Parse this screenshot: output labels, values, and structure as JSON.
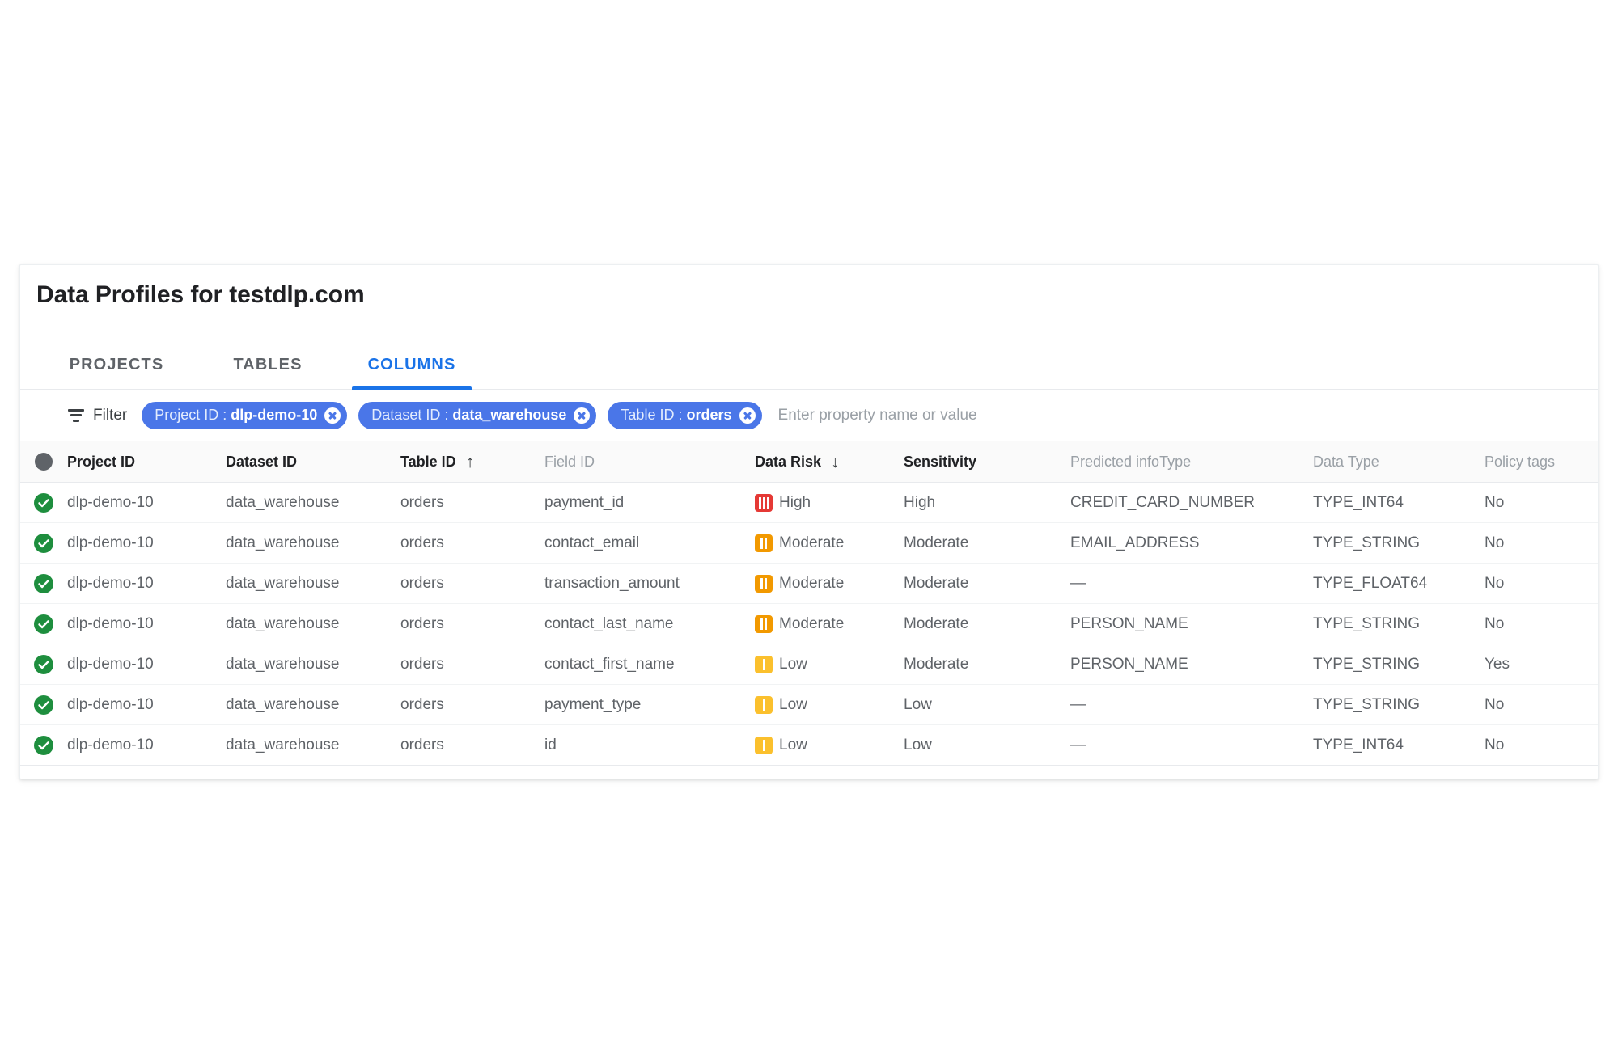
{
  "card": {
    "title": "Data Profiles for testdlp.com"
  },
  "tabs": [
    {
      "label": "PROJECTS",
      "active": false
    },
    {
      "label": "TABLES",
      "active": false
    },
    {
      "label": "COLUMNS",
      "active": true
    }
  ],
  "filter": {
    "icon": "filter-icon",
    "label": "Filter",
    "placeholder": "Enter property name or value",
    "value": "",
    "chips": [
      {
        "key": "Project ID",
        "sep": ":",
        "value": "dlp-demo-10"
      },
      {
        "key": "Dataset ID",
        "sep": ":",
        "value": "data_warehouse"
      },
      {
        "key": "Table ID",
        "sep": ":",
        "value": "orders"
      }
    ]
  },
  "table": {
    "select_all_icon": "filled-circle-icon",
    "columns": [
      {
        "label": "Project ID",
        "sorted": true,
        "arrow": ""
      },
      {
        "label": "Dataset ID",
        "sorted": false,
        "arrow": ""
      },
      {
        "label": "Table ID",
        "sorted": true,
        "arrow": "↑"
      },
      {
        "label": "Field ID",
        "sorted": false,
        "arrow": ""
      },
      {
        "label": "Data Risk",
        "sorted": true,
        "arrow": "↓"
      },
      {
        "label": "Sensitivity",
        "sorted": true,
        "arrow": ""
      },
      {
        "label": "Predicted infoType",
        "sorted": false,
        "arrow": ""
      },
      {
        "label": "Data Type",
        "sorted": false,
        "arrow": ""
      },
      {
        "label": "Policy tags",
        "sorted": false,
        "arrow": ""
      }
    ],
    "colors": {
      "risk_high": "#e53935",
      "risk_moderate": "#f29900",
      "risk_low": "#fbc02d",
      "status_ok": "#1e8e3e",
      "accent": "#1a73e8",
      "chip": "#4a76e8"
    },
    "rows": [
      {
        "status_icon": "check-circle-icon",
        "project_id": "dlp-demo-10",
        "dataset_id": "data_warehouse",
        "table_id": "orders",
        "field_id": "payment_id",
        "data_risk": "High",
        "risk_level": "high",
        "sensitivity": "High",
        "predicted_infotype": "CREDIT_CARD_NUMBER",
        "data_type": "TYPE_INT64",
        "policy_tags": "No"
      },
      {
        "status_icon": "check-circle-icon",
        "project_id": "dlp-demo-10",
        "dataset_id": "data_warehouse",
        "table_id": "orders",
        "field_id": "contact_email",
        "data_risk": "Moderate",
        "risk_level": "moderate",
        "sensitivity": "Moderate",
        "predicted_infotype": "EMAIL_ADDRESS",
        "data_type": "TYPE_STRING",
        "policy_tags": "No"
      },
      {
        "status_icon": "check-circle-icon",
        "project_id": "dlp-demo-10",
        "dataset_id": "data_warehouse",
        "table_id": "orders",
        "field_id": "transaction_amount",
        "data_risk": "Moderate",
        "risk_level": "moderate",
        "sensitivity": "Moderate",
        "predicted_infotype": "—",
        "data_type": "TYPE_FLOAT64",
        "policy_tags": "No"
      },
      {
        "status_icon": "check-circle-icon",
        "project_id": "dlp-demo-10",
        "dataset_id": "data_warehouse",
        "table_id": "orders",
        "field_id": "contact_last_name",
        "data_risk": "Moderate",
        "risk_level": "moderate",
        "sensitivity": "Moderate",
        "predicted_infotype": "PERSON_NAME",
        "data_type": "TYPE_STRING",
        "policy_tags": "No"
      },
      {
        "status_icon": "check-circle-icon",
        "project_id": "dlp-demo-10",
        "dataset_id": "data_warehouse",
        "table_id": "orders",
        "field_id": "contact_first_name",
        "data_risk": "Low",
        "risk_level": "low",
        "sensitivity": "Moderate",
        "predicted_infotype": "PERSON_NAME",
        "data_type": "TYPE_STRING",
        "policy_tags": "Yes"
      },
      {
        "status_icon": "check-circle-icon",
        "project_id": "dlp-demo-10",
        "dataset_id": "data_warehouse",
        "table_id": "orders",
        "field_id": "payment_type",
        "data_risk": "Low",
        "risk_level": "low",
        "sensitivity": "Low",
        "predicted_infotype": "—",
        "data_type": "TYPE_STRING",
        "policy_tags": "No"
      },
      {
        "status_icon": "check-circle-icon",
        "project_id": "dlp-demo-10",
        "dataset_id": "data_warehouse",
        "table_id": "orders",
        "field_id": "id",
        "data_risk": "Low",
        "risk_level": "low",
        "sensitivity": "Low",
        "predicted_infotype": "—",
        "data_type": "TYPE_INT64",
        "policy_tags": "No"
      }
    ]
  }
}
